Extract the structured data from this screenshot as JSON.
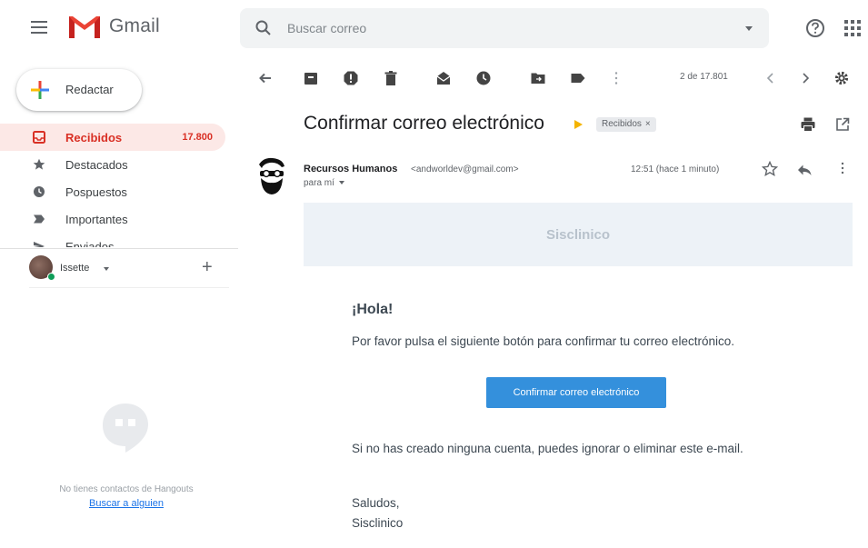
{
  "header": {
    "app_name": "Gmail",
    "search_placeholder": "Buscar correo"
  },
  "sidebar": {
    "compose_label": "Redactar",
    "items": [
      {
        "label": "Recibidos",
        "count": "17.800",
        "icon": "inbox-icon",
        "active": true
      },
      {
        "label": "Destacados",
        "count": "",
        "icon": "star-icon"
      },
      {
        "label": "Pospuestos",
        "count": "",
        "icon": "clock-icon"
      },
      {
        "label": "Importantes",
        "count": "",
        "icon": "important-icon"
      },
      {
        "label": "Enviados",
        "count": "",
        "icon": "send-icon"
      }
    ],
    "hangouts_user": "Issette",
    "hangouts_empty_text": "No tienes contactos de Hangouts",
    "hangouts_search_link": "Buscar a alguien"
  },
  "toolbar": {
    "pager": "2 de 17.801"
  },
  "email": {
    "subject": "Confirmar correo electrónico",
    "label": "Recibidos",
    "sender_name": "Recursos Humanos",
    "sender_email": "<andworldev@gmail.com>",
    "to": "para mí",
    "time": "12:51 (hace 1 minuto)",
    "banner": "Sisclinico",
    "greeting": "¡Hola!",
    "intro": "Por favor pulsa el siguiente botón para confirmar tu correo electrónico.",
    "button_label": "Confirmar correo electrónico",
    "ignore_text": "Si no has creado ninguna cuenta, puedes ignorar o eliminar este e-mail.",
    "closing": "Saludos,",
    "signature": "Sisclinico"
  },
  "colors": {
    "gmail_red": "#d93025",
    "active_bg": "#fce8e6",
    "button_blue": "#3490dc",
    "banner_bg": "#edf2f7",
    "label_arrow": "#f4b400"
  }
}
